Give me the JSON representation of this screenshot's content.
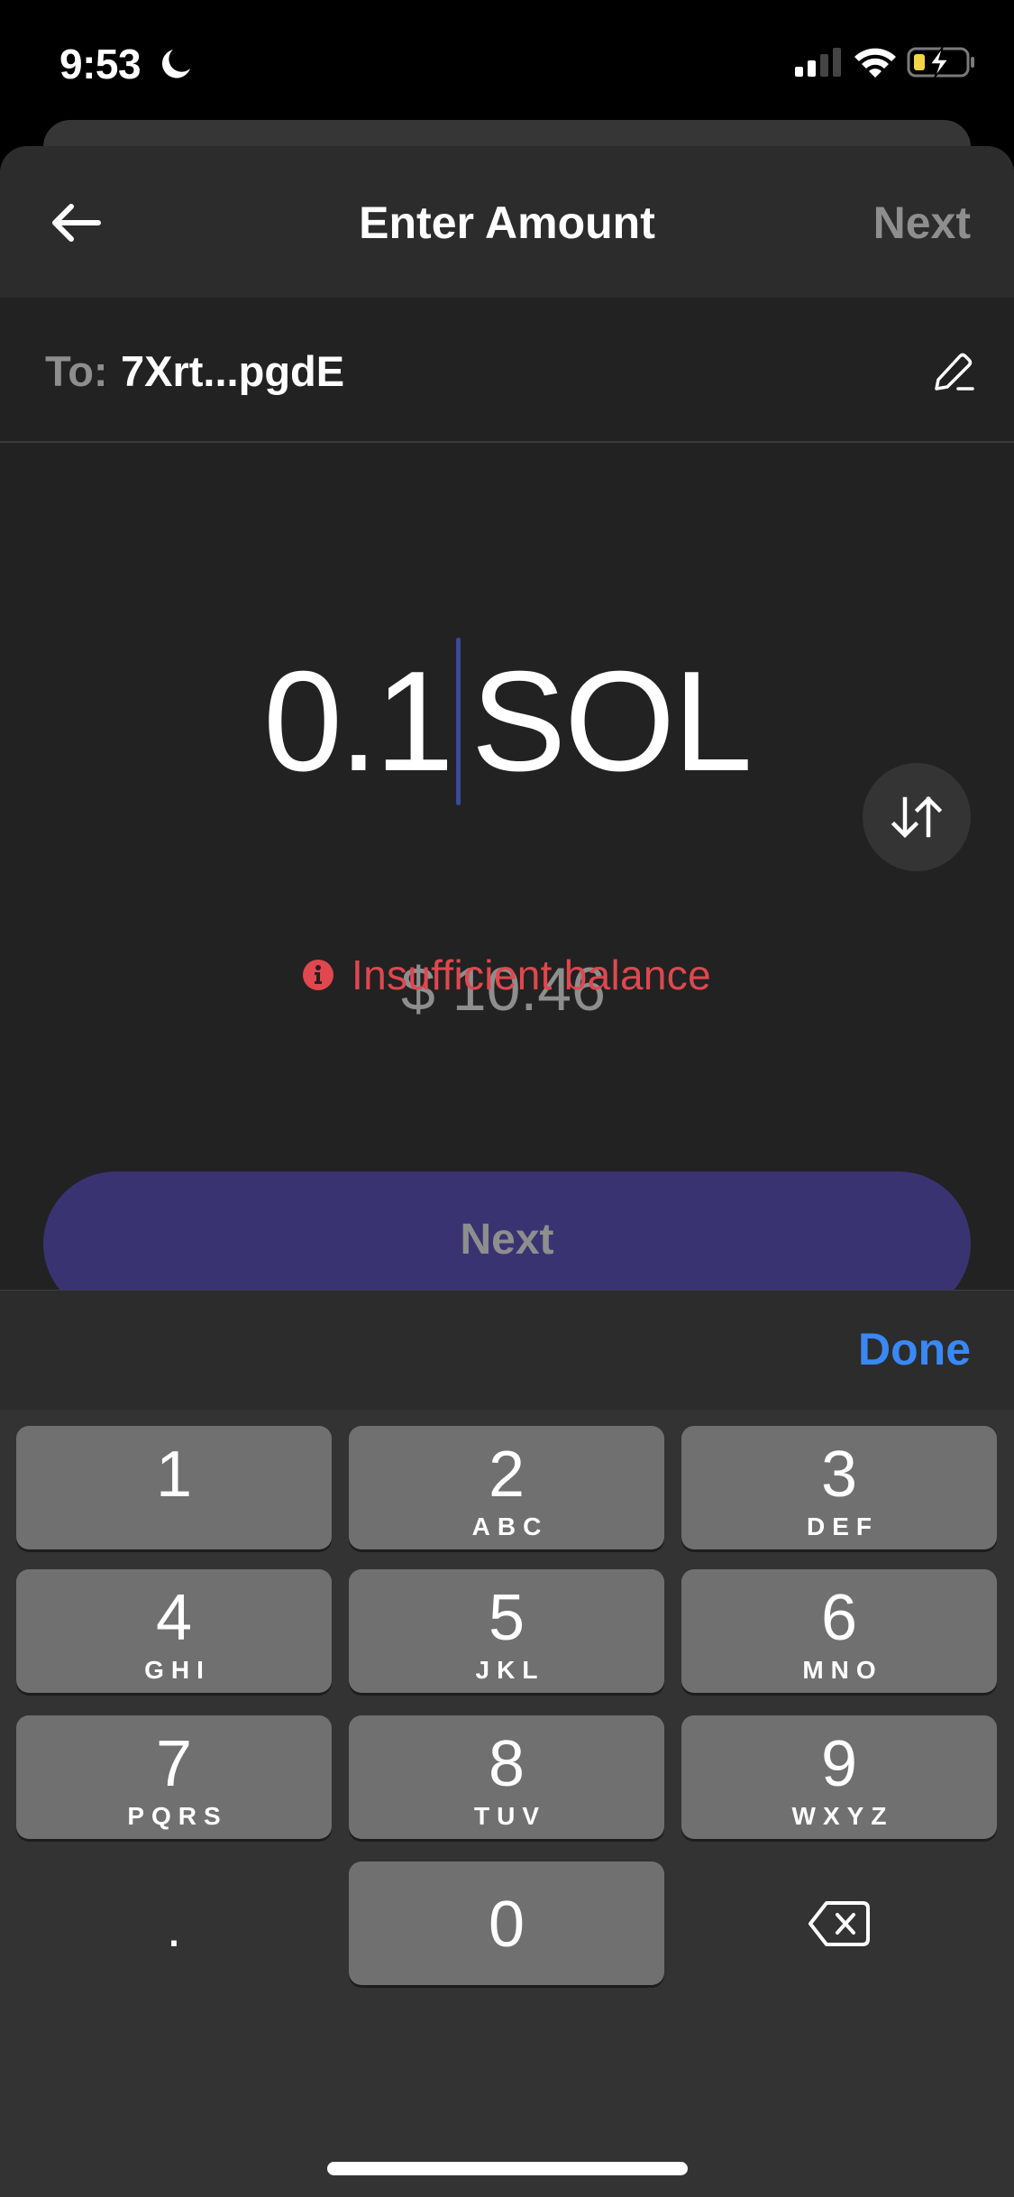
{
  "status_bar": {
    "time": "9:53",
    "focus_icon": "moon-icon",
    "signal_bars_active": 2,
    "signal_bars_total": 4,
    "wifi_icon": "wifi-icon",
    "battery_icon": "battery-charging-icon",
    "battery_color": "#f5d547"
  },
  "header": {
    "back_icon": "arrow-left-icon",
    "title": "Enter Amount",
    "next_label": "Next"
  },
  "recipient": {
    "label": "To:",
    "address": "7Xrt...pgdE",
    "edit_icon": "pencil-icon"
  },
  "amount": {
    "value": "0.1",
    "unit": "SOL",
    "fiat": "$ 10.46",
    "swap_icon": "swap-vertical-icon"
  },
  "error": {
    "icon": "info-circle-icon",
    "text": "Insufficient balance",
    "color": "#e0474f"
  },
  "primary_button": {
    "label": "Next",
    "color": "#3a3372"
  },
  "keyboard_toolbar": {
    "done_label": "Done",
    "done_color": "#3a88f5"
  },
  "keypad": {
    "keys": [
      {
        "digit": "1",
        "letters": ""
      },
      {
        "digit": "2",
        "letters": "ABC"
      },
      {
        "digit": "3",
        "letters": "DEF"
      },
      {
        "digit": "4",
        "letters": "GHI"
      },
      {
        "digit": "5",
        "letters": "JKL"
      },
      {
        "digit": "6",
        "letters": "MNO"
      },
      {
        "digit": "7",
        "letters": "PQRS"
      },
      {
        "digit": "8",
        "letters": "TUV"
      },
      {
        "digit": "9",
        "letters": "WXYZ"
      }
    ],
    "decimal": ".",
    "zero": "0",
    "delete_icon": "backspace-icon"
  }
}
